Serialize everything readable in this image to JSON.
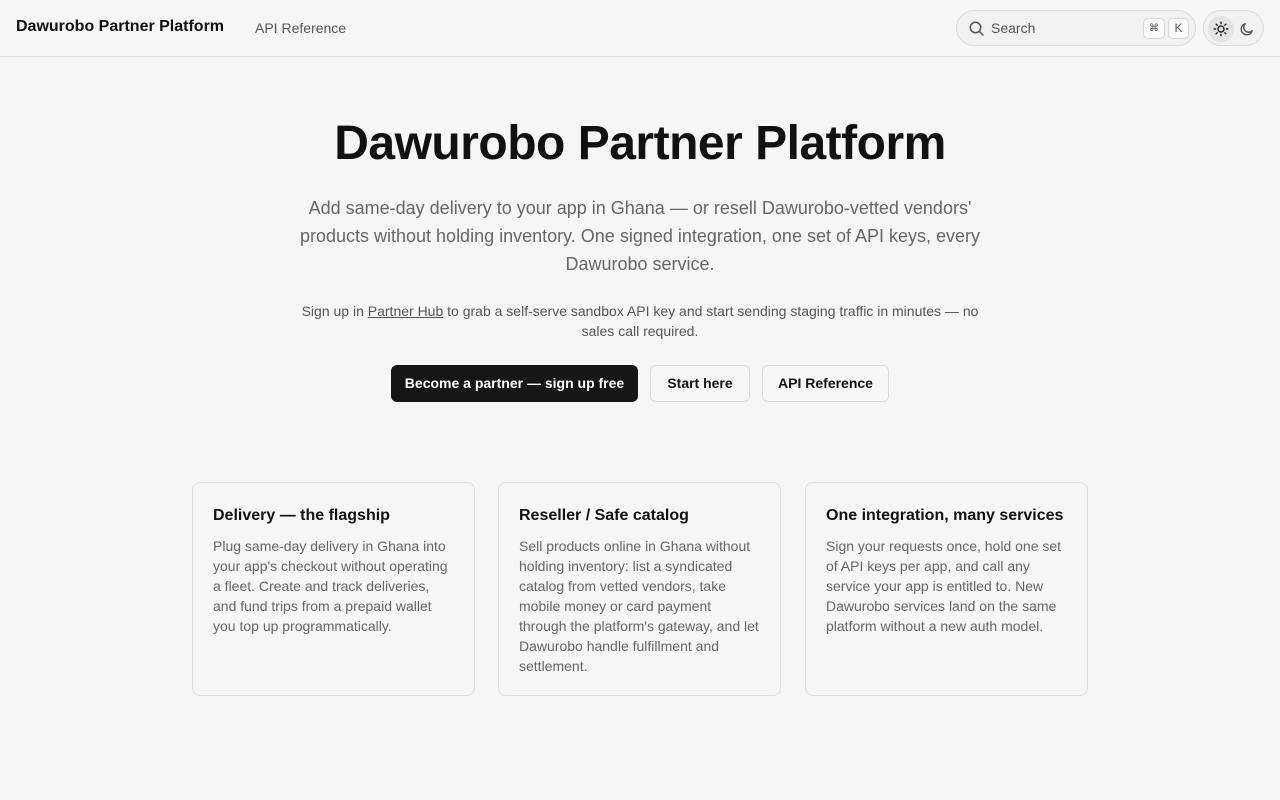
{
  "header": {
    "brand": "Dawurobo Partner Platform",
    "nav": [
      {
        "label": "API Reference"
      }
    ],
    "search": {
      "label": "Search",
      "shortcut_mod": "⌘",
      "shortcut_key": "K"
    },
    "theme": {
      "options": [
        "light",
        "dark"
      ],
      "selected": "light"
    }
  },
  "hero": {
    "title": "Dawurobo Partner Platform",
    "subtitle": "Add same-day delivery to your app in Ghana — or resell Dawurobo-vetted vendors' products without holding inventory. One signed integration, one set of API keys, every Dawurobo service.",
    "note_before": "Sign up in ",
    "note_link": "Partner Hub",
    "note_after": " to grab a self-serve sandbox API key and start sending staging traffic in minutes — no sales call required.",
    "buttons": {
      "primary": "Become a partner — sign up free",
      "start": "Start here",
      "api_reference": "API Reference"
    }
  },
  "cards": [
    {
      "title": "Delivery — the flagship",
      "body": "Plug same-day delivery in Ghana into your app's checkout without operating a fleet. Create and track deliveries, and fund trips from a prepaid wallet you top up programmatically."
    },
    {
      "title": "Reseller / Safe catalog",
      "body": "Sell products online in Ghana without holding inventory: list a syndicated catalog from vetted vendors, take mobile money or card payment through the platform's gateway, and let Dawurobo handle fulfillment and settlement."
    },
    {
      "title": "One integration, many services",
      "body": "Sign your requests once, hold one set of API keys per app, and call any service your app is entitled to. New Dawurobo services land on the same platform without a new auth model."
    }
  ],
  "colors": {
    "background": "#f6f6f6",
    "primary_button": "#161616",
    "text": "#111111",
    "muted_text": "#666666"
  }
}
